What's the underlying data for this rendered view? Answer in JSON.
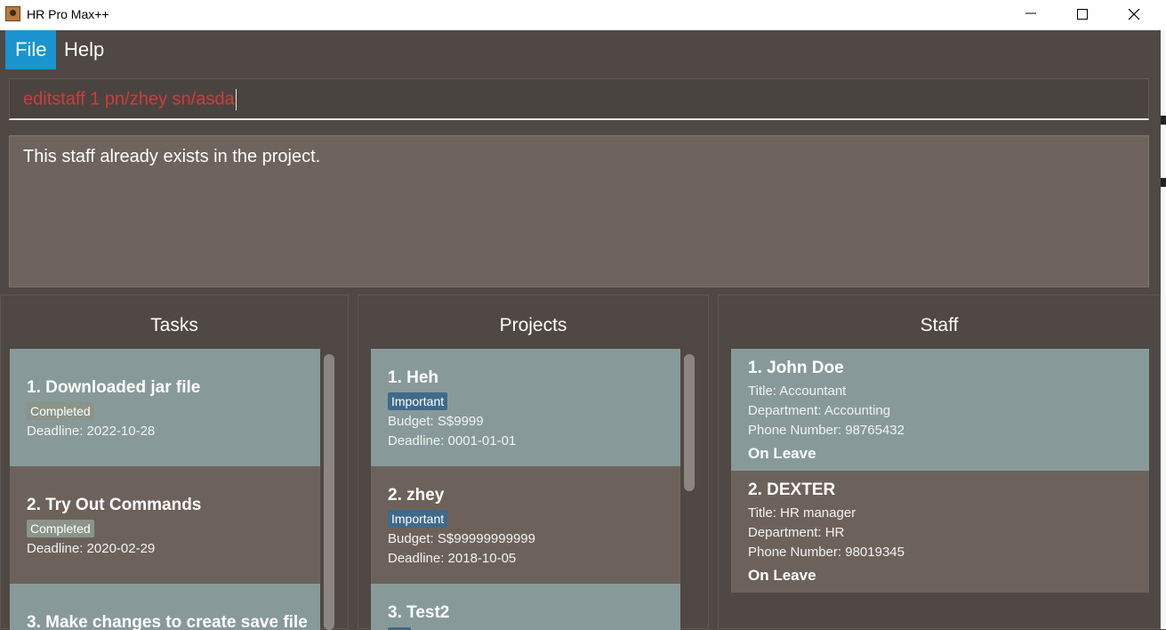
{
  "window": {
    "title": "HR Pro Max++",
    "icon": "app-icon",
    "controls": [
      "minimize-icon",
      "maximize-icon",
      "close-icon"
    ]
  },
  "menu": {
    "file_label": "File",
    "help_label": "Help"
  },
  "command": {
    "value": "editstaff 1 pn/zhey sn/asda"
  },
  "result": {
    "message": "This staff already exists in the project."
  },
  "tasks": {
    "title": "Tasks",
    "items": [
      {
        "title": "1.  Downloaded jar file",
        "status": "Completed",
        "deadline": "Deadline: 2022-10-28"
      },
      {
        "title": "2.  Try Out Commands",
        "status": "Completed",
        "deadline": "Deadline: 2020-02-29"
      },
      {
        "title": "3.  Make changes to create save file"
      }
    ]
  },
  "projects": {
    "title": "Projects",
    "items": [
      {
        "title": "1.  Heh",
        "tag": "Important",
        "budget": "Budget: S$9999",
        "deadline": "Deadline: 0001-01-01"
      },
      {
        "title": "2.  zhey",
        "tag": "Important",
        "budget": "Budget: S$99999999999",
        "deadline": "Deadline: 2018-10-05"
      },
      {
        "title": "3.  Test2"
      }
    ]
  },
  "staff": {
    "title": "Staff",
    "items": [
      {
        "title": "1.  John Doe",
        "role": "Title: Accountant",
        "department": "Department: Accounting",
        "phone": "Phone Number: 98765432",
        "status": "On Leave"
      },
      {
        "title": "2.  DEXTER",
        "role": "Title: HR manager",
        "department": "Department: HR",
        "phone": "Phone Number: 98019345",
        "status": "On Leave"
      }
    ]
  },
  "colors": {
    "background": "#4f4844",
    "accent_menu": "#1a95cf",
    "card_light": "#879a99",
    "card_dark": "#6d625b",
    "badge_important": "#3f6a8b",
    "badge_completed": "#8a9488",
    "command_error_text": "#d23a3a"
  }
}
